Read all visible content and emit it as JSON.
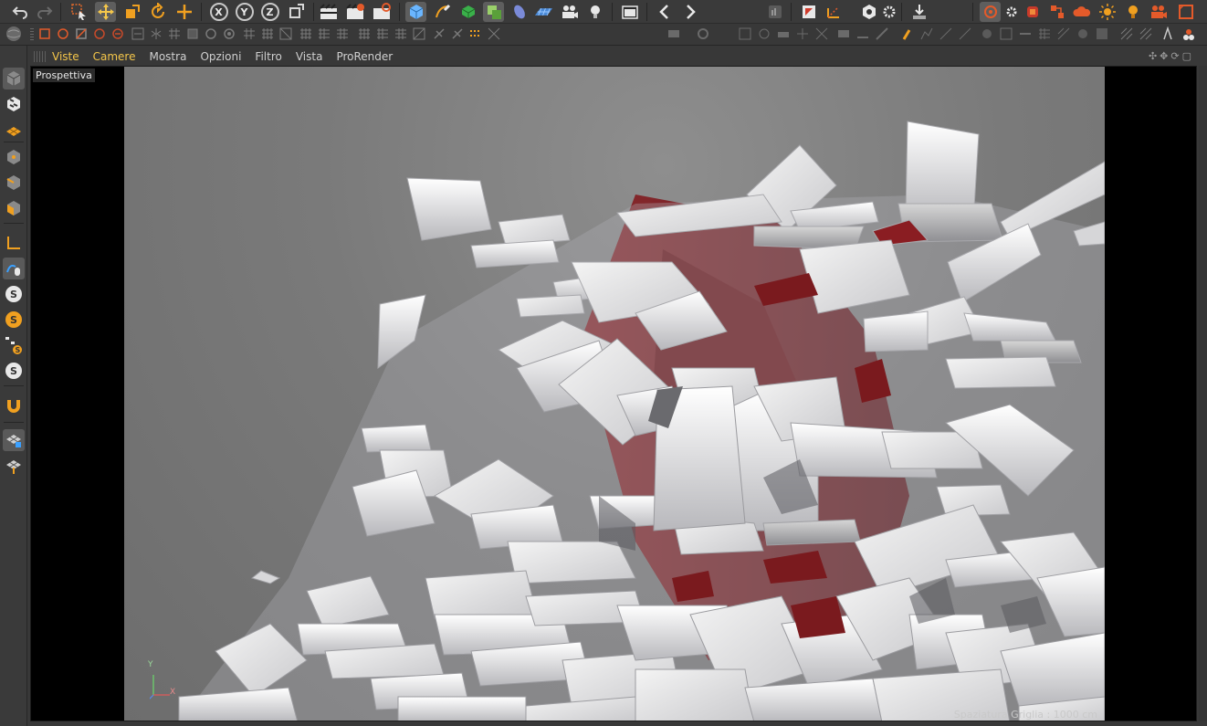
{
  "viewport_menu": {
    "items": [
      "Viste",
      "Camere",
      "Mostra",
      "Opzioni",
      "Filtro",
      "Vista",
      "ProRender"
    ]
  },
  "viewport": {
    "view_name": "Prospettiva",
    "grid_spacing": "Spaziatura Griglia : 1000 cm",
    "axis_y": "Y",
    "axis_x": "X"
  },
  "toolbar": {
    "axis_x": "X",
    "axis_y": "Y",
    "axis_z": "Z"
  },
  "colors": {
    "accent": "#f4c64a",
    "active_blue": "#3aa0ff",
    "orange": "#f0a020",
    "red": "#d04028"
  },
  "icons": [
    "undo-icon",
    "redo-icon",
    "live-selection-icon",
    "move-icon",
    "scale-icon",
    "rotate-icon",
    "last-tool-icon",
    "x-axis-icon",
    "y-axis-icon",
    "z-axis-icon",
    "world-coord-icon",
    "render-view-icon",
    "render-picture-viewer-icon",
    "render-settings-icon",
    "cube-icon",
    "pen-icon",
    "subdivision-icon",
    "array-icon",
    "deformer-icon",
    "floor-icon",
    "camera-icon",
    "light-icon",
    "clapper-icon",
    "prev-icon",
    "next-icon"
  ]
}
